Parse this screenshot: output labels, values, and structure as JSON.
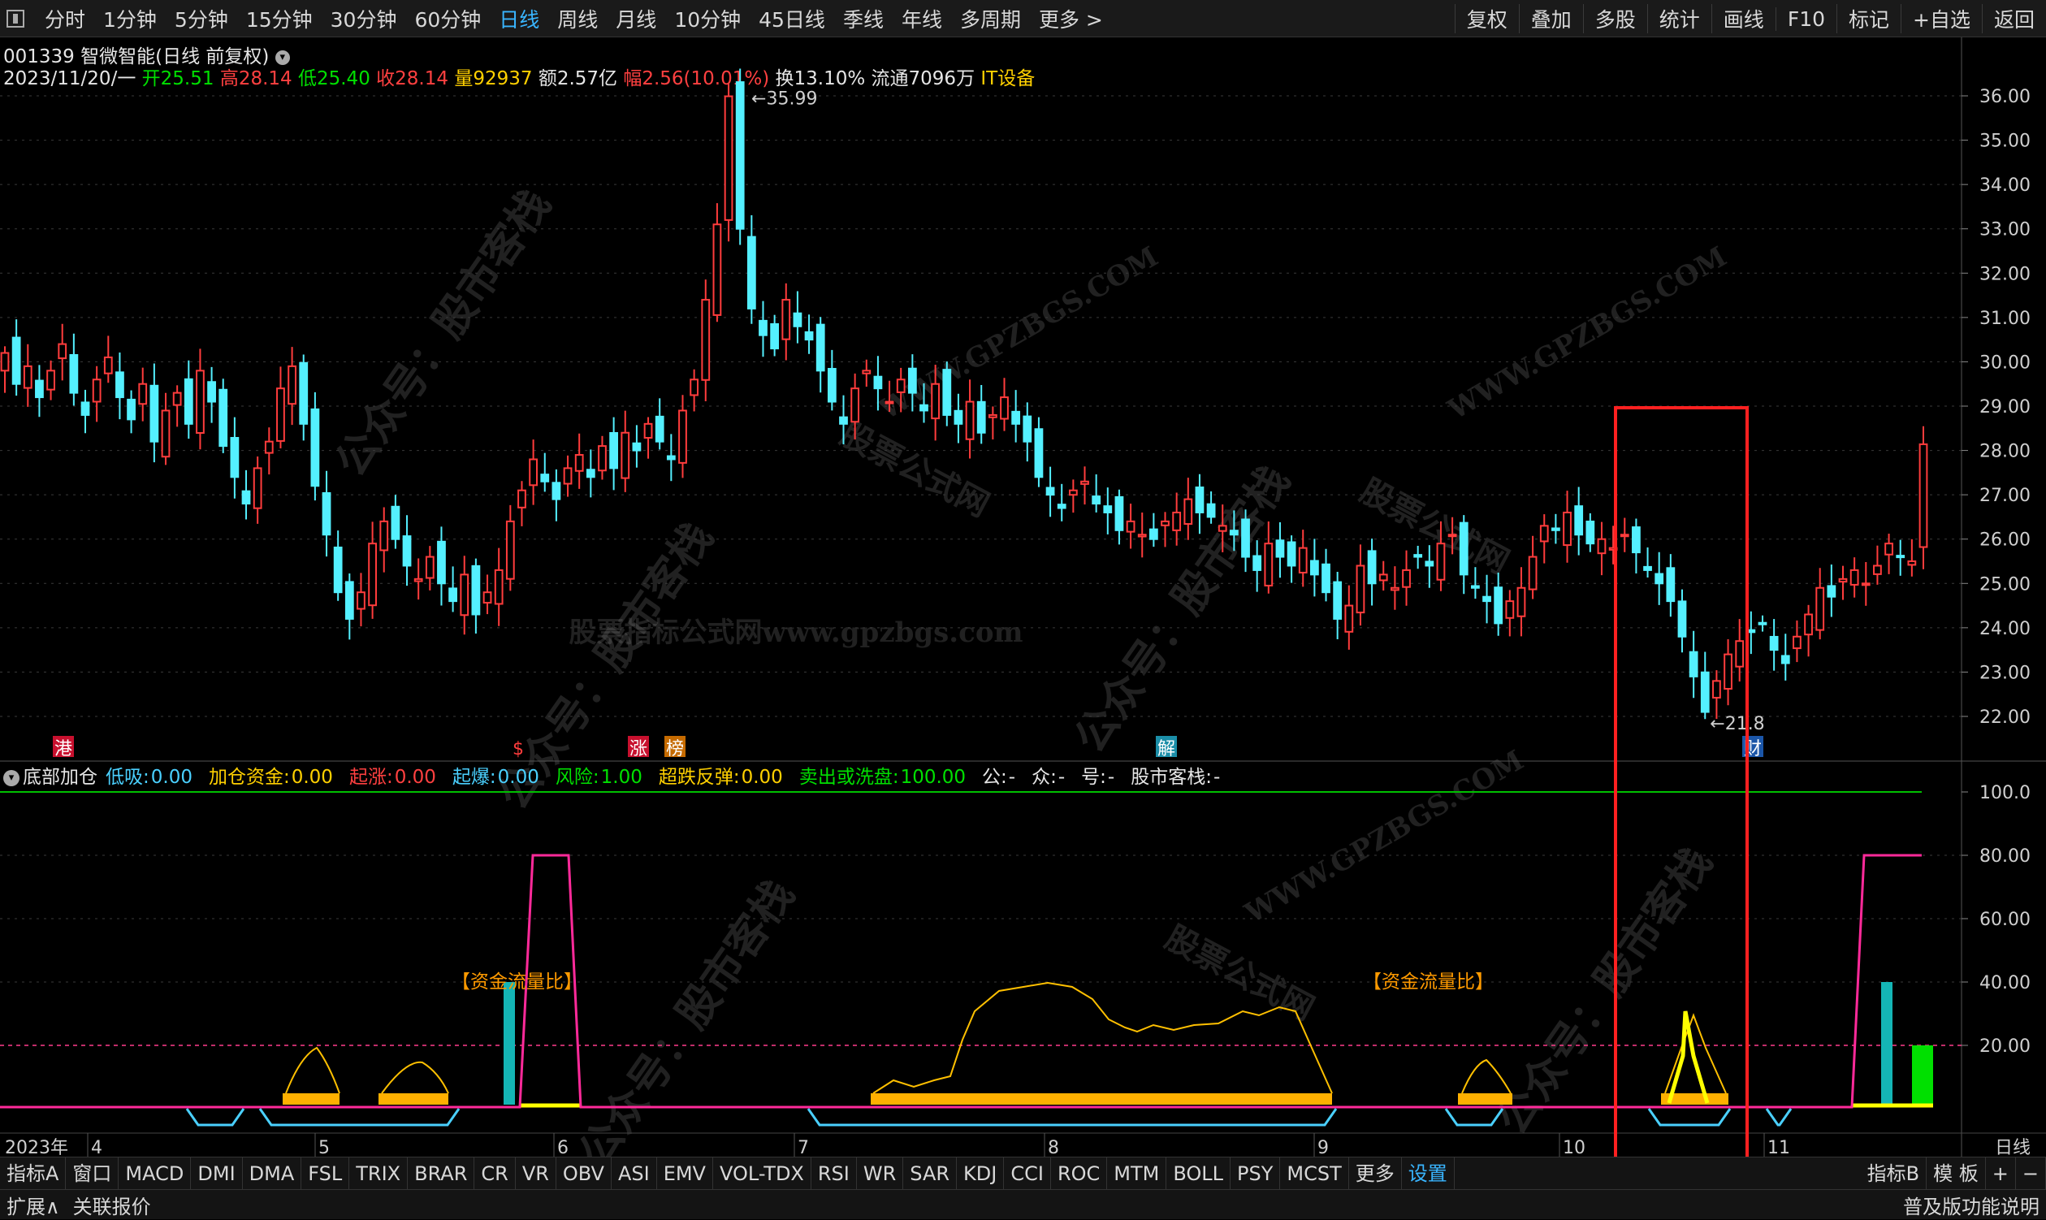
{
  "toolbar": {
    "periods": [
      "分时",
      "1分钟",
      "5分钟",
      "15分钟",
      "30分钟",
      "60分钟",
      "日线",
      "周线",
      "月线",
      "10分钟",
      "45日线",
      "季线",
      "年线",
      "多周期",
      "更多 >"
    ],
    "active_period": "日线",
    "right": [
      "复权",
      "叠加",
      "多股",
      "统计",
      "画线",
      "F10",
      "标记",
      "+自选",
      "返回"
    ]
  },
  "stock": {
    "code": "001339",
    "name": "智微智能",
    "mode": "(日线 前复权)",
    "date": "2023/11/20/一",
    "open_label": "开",
    "open": "25.51",
    "high_label": "高",
    "high": "28.14",
    "low_label": "低",
    "low": "25.40",
    "close_label": "收",
    "close": "28.14",
    "vol_label": "量",
    "vol": "92937",
    "amt_label": "额",
    "amt": "2.57亿",
    "chg_label": "幅",
    "chg": "2.56(10.01%)",
    "turn_label": "换",
    "turn": "13.10%",
    "float_label": "流通",
    "float": "7096万",
    "sector": "IT设备"
  },
  "price_axis": [
    "36.00",
    "35.00",
    "34.00",
    "33.00",
    "32.00",
    "31.00",
    "30.00",
    "29.00",
    "28.00",
    "27.00",
    "26.00",
    "25.00",
    "24.00",
    "23.00",
    "22.00"
  ],
  "price_marks": {
    "high": "35.99",
    "low": "21.8"
  },
  "event_tags": [
    "港",
    "$",
    "涨",
    "榜",
    "解",
    "财"
  ],
  "indicator": {
    "name": "底部加仓",
    "items": [
      {
        "label": "低吸:",
        "value": "0.00",
        "color": "#4ad0ff"
      },
      {
        "label": "加仓资金:",
        "value": "0.00",
        "color": "#ffd000"
      },
      {
        "label": "起涨:",
        "value": "0.00",
        "color": "#ff4040"
      },
      {
        "label": "起爆:",
        "value": "0.00",
        "color": "#4ad0ff"
      },
      {
        "label": "风险:",
        "value": "1.00",
        "color": "#00e000"
      },
      {
        "label": "超跌反弹:",
        "value": "0.00",
        "color": "#ffd000"
      },
      {
        "label": "卖出或洗盘:",
        "value": "100.00",
        "color": "#00e000"
      },
      {
        "label": "公:",
        "value": "-",
        "color": "#e6e6e6"
      },
      {
        "label": "众:",
        "value": "-",
        "color": "#e6e6e6"
      },
      {
        "label": "号:",
        "value": "-",
        "color": "#e6e6e6"
      },
      {
        "label": "股市客栈:",
        "value": "-",
        "color": "#e6e6e6"
      }
    ],
    "axis": [
      "100.0",
      "80.00",
      "60.00",
      "40.00",
      "20.00"
    ],
    "annotation": "【资金流量比】"
  },
  "time_axis": {
    "year": "2023年",
    "months": [
      "4",
      "5",
      "6",
      "7",
      "8",
      "9",
      "10",
      "11"
    ],
    "period": "日线"
  },
  "bottom_tabs": [
    "指标A",
    "窗口",
    "MACD",
    "DMI",
    "DMA",
    "FSL",
    "TRIX",
    "BRAR",
    "CR",
    "VR",
    "OBV",
    "ASI",
    "EMV",
    "VOL-TDX",
    "RSI",
    "WR",
    "SAR",
    "KDJ",
    "CCI",
    "ROC",
    "MTM",
    "BOLL",
    "PSY",
    "MCST",
    "更多",
    "设置"
  ],
  "bottom_right": [
    "指标B",
    "模 板",
    "+",
    "−"
  ],
  "status": {
    "left": [
      "扩展∧",
      "关联报价"
    ],
    "right": "普及版功能说明"
  },
  "watermarks": [
    "公众号：股市客栈",
    "WWW.GPZBGS.COM",
    "股票公式网",
    "股票指标公式网www.gpzbgs.com"
  ],
  "chart_data": {
    "type": "candlestick",
    "ylim": [
      21.5,
      36.5
    ],
    "high": 35.99,
    "low": 21.8,
    "last_close": 28.14,
    "closes": [
      30.2,
      29.5,
      29.9,
      29.2,
      29.8,
      30.4,
      29.3,
      28.8,
      29.6,
      30.1,
      29.2,
      28.7,
      29.5,
      28.2,
      28.9,
      29.3,
      28.6,
      29.8,
      29.1,
      28.1,
      27.4,
      26.8,
      27.6,
      28.2,
      29.4,
      29.9,
      28.6,
      27.2,
      26.1,
      24.8,
      24.2,
      24.8,
      25.9,
      26.4,
      26.0,
      25.4,
      25.1,
      25.6,
      25.0,
      24.6,
      25.2,
      24.3,
      24.8,
      25.3,
      26.4,
      27.1,
      27.8,
      27.3,
      26.9,
      27.6,
      27.9,
      27.4,
      28.1,
      27.6,
      28.4,
      28.0,
      28.6,
      28.2,
      27.8,
      28.9,
      29.6,
      31.4,
      33.1,
      35.99,
      33.0,
      31.2,
      30.6,
      30.3,
      31.4,
      30.8,
      30.5,
      29.8,
      29.1,
      28.6,
      29.4,
      29.8,
      29.4,
      29.1,
      29.6,
      29.3,
      28.9,
      29.5,
      28.8,
      28.6,
      29.1,
      28.4,
      28.8,
      29.2,
      28.6,
      28.2,
      27.4,
      27.0,
      26.7,
      27.1,
      27.3,
      26.8,
      26.6,
      26.2,
      26.4,
      26.1,
      26.0,
      26.4,
      26.6,
      26.9,
      26.6,
      26.5,
      26.3,
      26.1,
      25.6,
      25.3,
      25.9,
      25.6,
      25.4,
      25.8,
      25.2,
      24.8,
      24.2,
      24.5,
      25.4,
      25.0,
      25.2,
      24.9,
      25.3,
      25.6,
      25.4,
      25.9,
      26.1,
      25.2,
      24.9,
      24.6,
      24.1,
      24.6,
      24.9,
      25.6,
      26.3,
      26.2,
      26.6,
      26.1,
      25.9,
      26.0,
      25.8,
      26.1,
      25.7,
      25.3,
      25.0,
      24.6,
      23.8,
      22.9,
      22.1,
      22.8,
      23.4,
      23.7,
      23.9,
      24.1,
      23.5,
      23.2,
      23.8,
      24.3,
      24.9,
      24.7,
      25.1,
      25.3,
      25.0,
      25.4,
      25.9,
      25.6,
      25.5,
      28.14
    ]
  }
}
